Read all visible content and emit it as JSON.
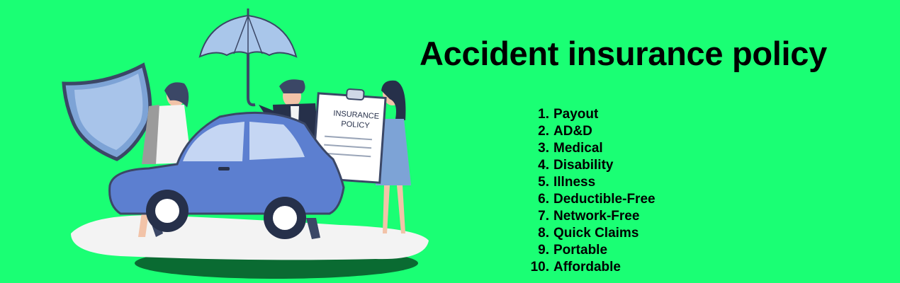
{
  "title": "Accident insurance policy",
  "features": [
    {
      "num": "1.",
      "label": "Payout"
    },
    {
      "num": "2.",
      "label": "AD&D"
    },
    {
      "num": "3.",
      "label": "Medical"
    },
    {
      "num": "4.",
      "label": "Disability"
    },
    {
      "num": "5.",
      "label": "Illness"
    },
    {
      "num": "6.",
      "label": "Deductible-Free"
    },
    {
      "num": "7.",
      "label": "Network-Free"
    },
    {
      "num": "8.",
      "label": "Quick Claims"
    },
    {
      "num": "9.",
      "label": "Portable"
    },
    {
      "num": "10.",
      "label": "Affordable"
    }
  ],
  "illustration": {
    "clipboard_text_line1": "INSURANCE",
    "clipboard_text_line2": "POLICY"
  },
  "colors": {
    "background": "#1aff74",
    "car": "#5c7fd0",
    "shield": "#8fb3df",
    "umbrella": "#a9c6ea",
    "text": "#000000"
  }
}
